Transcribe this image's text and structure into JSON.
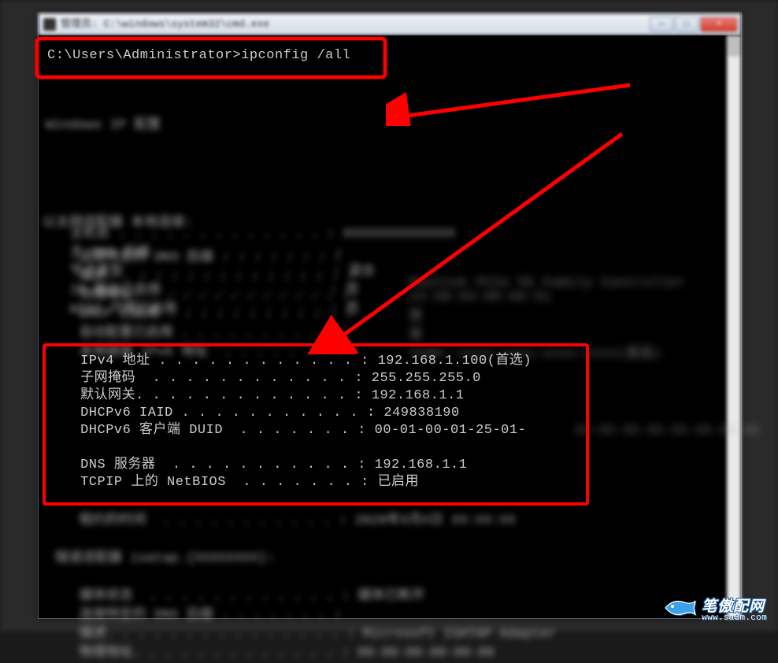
{
  "window": {
    "title": "管理员: C:\\windows\\system32\\cmd.exe",
    "controls": {
      "min": "—",
      "max": "□",
      "close": "×"
    }
  },
  "cmd": {
    "prompt": "C:\\Users\\Administrator>ipconfig /all"
  },
  "blurred": {
    "header": "Windows IP 配置",
    "host_block": "   主机名 . . . . . . . . . . . . . : XXXXXXXXXXXXXX\n   主 DNS 后缀 . . . . . . . . . . . :\n   节点类型  . . . . . . . . . . . . : 混合\n   IP 路由已启用 . . . . . . . . . . : 否\n   WINS 代理已启用 . . . . . . . . . : 否",
    "adapter_header": "以太网适配器 本地连接:",
    "adapter_block": "   连接特定的 DNS 后缀 . . . . . . . :\n   描述. . . . . . . . . . . . . . . :\n   物理地址. . . . . . . . . . . . . :\n   DHCP 已启用 . . . . . . . . . . . :\n   自动配置已启用 . . . . . . . . . . :\n   本地链接 IPv6 地址  . . . . . . . :",
    "adapter_values": "Realtek PCIe FE Family Controller\n14-58-63-00-09-51\n是\n是\nfe80::xxxx:xxxx:xxxx:xxxx(首选)",
    "tail_block": "   租约的时间  . . . . . . . . . . . : 2020年X月X日 XX:XX:XX\n\n隧道适配器 isatap.{XXXXXXXX}:\n\n   媒体状态  . . . . . . . . . . . . : 媒体已断开\n   连接特定的 DNS 后缀 . . . . . . . :\n   描述. . . . . . . . . . . . . . . : Microsoft ISATAP Adapter\n   物理地址. . . . . . . . . . . . . : 00-00-00-00-00-00",
    "duid_tail": "XX-XX-XX-XX-XX-XX-XX-XX"
  },
  "network": {
    "ipv4_label": "   IPv4 地址 . . . . . . . . . . . . : ",
    "ipv4_value": "192.168.1.100(首选)",
    "subnet_label": "   子网掩码  . . . . . . . . . . . . : ",
    "subnet_value": "255.255.255.0",
    "gateway_label": "   默认网关. . . . . . . . . . . . . : ",
    "gateway_value": "192.168.1.1",
    "iaid_label": "   DHCPv6 IAID . . . . . . . . . . . : ",
    "iaid_value": "249838190",
    "duid_label": "   DHCPv6 客户端 DUID  . . . . . . . : ",
    "duid_value": "00-01-00-01-25-01-",
    "dns_label": "   DNS 服务器  . . . . . . . . . . . : ",
    "dns_value": "192.168.1.1",
    "netbios_label": "   TCPIP 上的 NetBIOS  . . . . . . . : ",
    "netbios_value": "已启用"
  },
  "annotations": {
    "highlight_color": "#ff0000"
  },
  "watermark": {
    "cn": "笔傲配网",
    "url": "www.sa3m.com"
  }
}
